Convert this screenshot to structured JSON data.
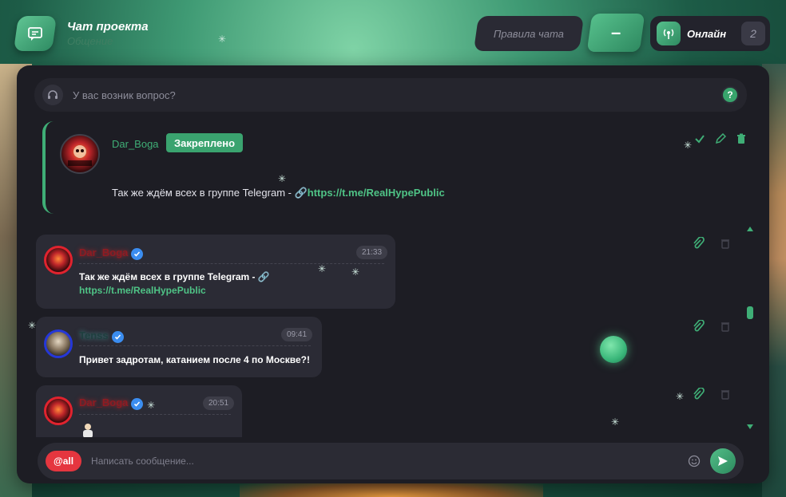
{
  "header": {
    "title": "Чат проекта",
    "subtitle": "Общение",
    "rules_button": "Правила чата",
    "minus_button": "–",
    "online_label": "Онлайн",
    "online_count": "2"
  },
  "question_bar": {
    "text": "У вас возник вопрос?",
    "help_glyph": "?"
  },
  "pinned": {
    "author": "Dar_Boga",
    "badge": "Закреплено",
    "text": "Так же ждём всех в группе Telegram - ",
    "link_icon": "🔗",
    "link": "https://t.me/RealHypePublic",
    "avatar_text": "DAR_BOGA"
  },
  "messages": [
    {
      "author": "Dar_Boga",
      "time": "21:33",
      "line1": "Так же ждём всех в группе Telegram - ",
      "link_icon": "🔗",
      "link": "https://t.me/RealHypePublic"
    },
    {
      "author": "Tenss",
      "time": "09:41",
      "line1": "Привет задротам, катанием после 4 по Москве?!"
    },
    {
      "author": "Dar_Boga",
      "time": "20:51"
    }
  ],
  "input": {
    "mention_button": "@all",
    "placeholder": "Написать сообщение..."
  },
  "colors": {
    "accent": "#3fae76",
    "panel": "#1d1d24",
    "bubble": "#2b2b35",
    "mention": "#e5363f",
    "verified": "#3b8df0"
  },
  "icons": {
    "chat_logo": "chat-icon",
    "online": "broadcast-icon",
    "question": "headset-icon",
    "help": "question-icon",
    "confirm": "check-icon",
    "edit": "pencil-icon",
    "delete": "trash-icon",
    "attach": "paperclip-icon",
    "emoji": "smiley-icon",
    "send": "send-icon"
  }
}
